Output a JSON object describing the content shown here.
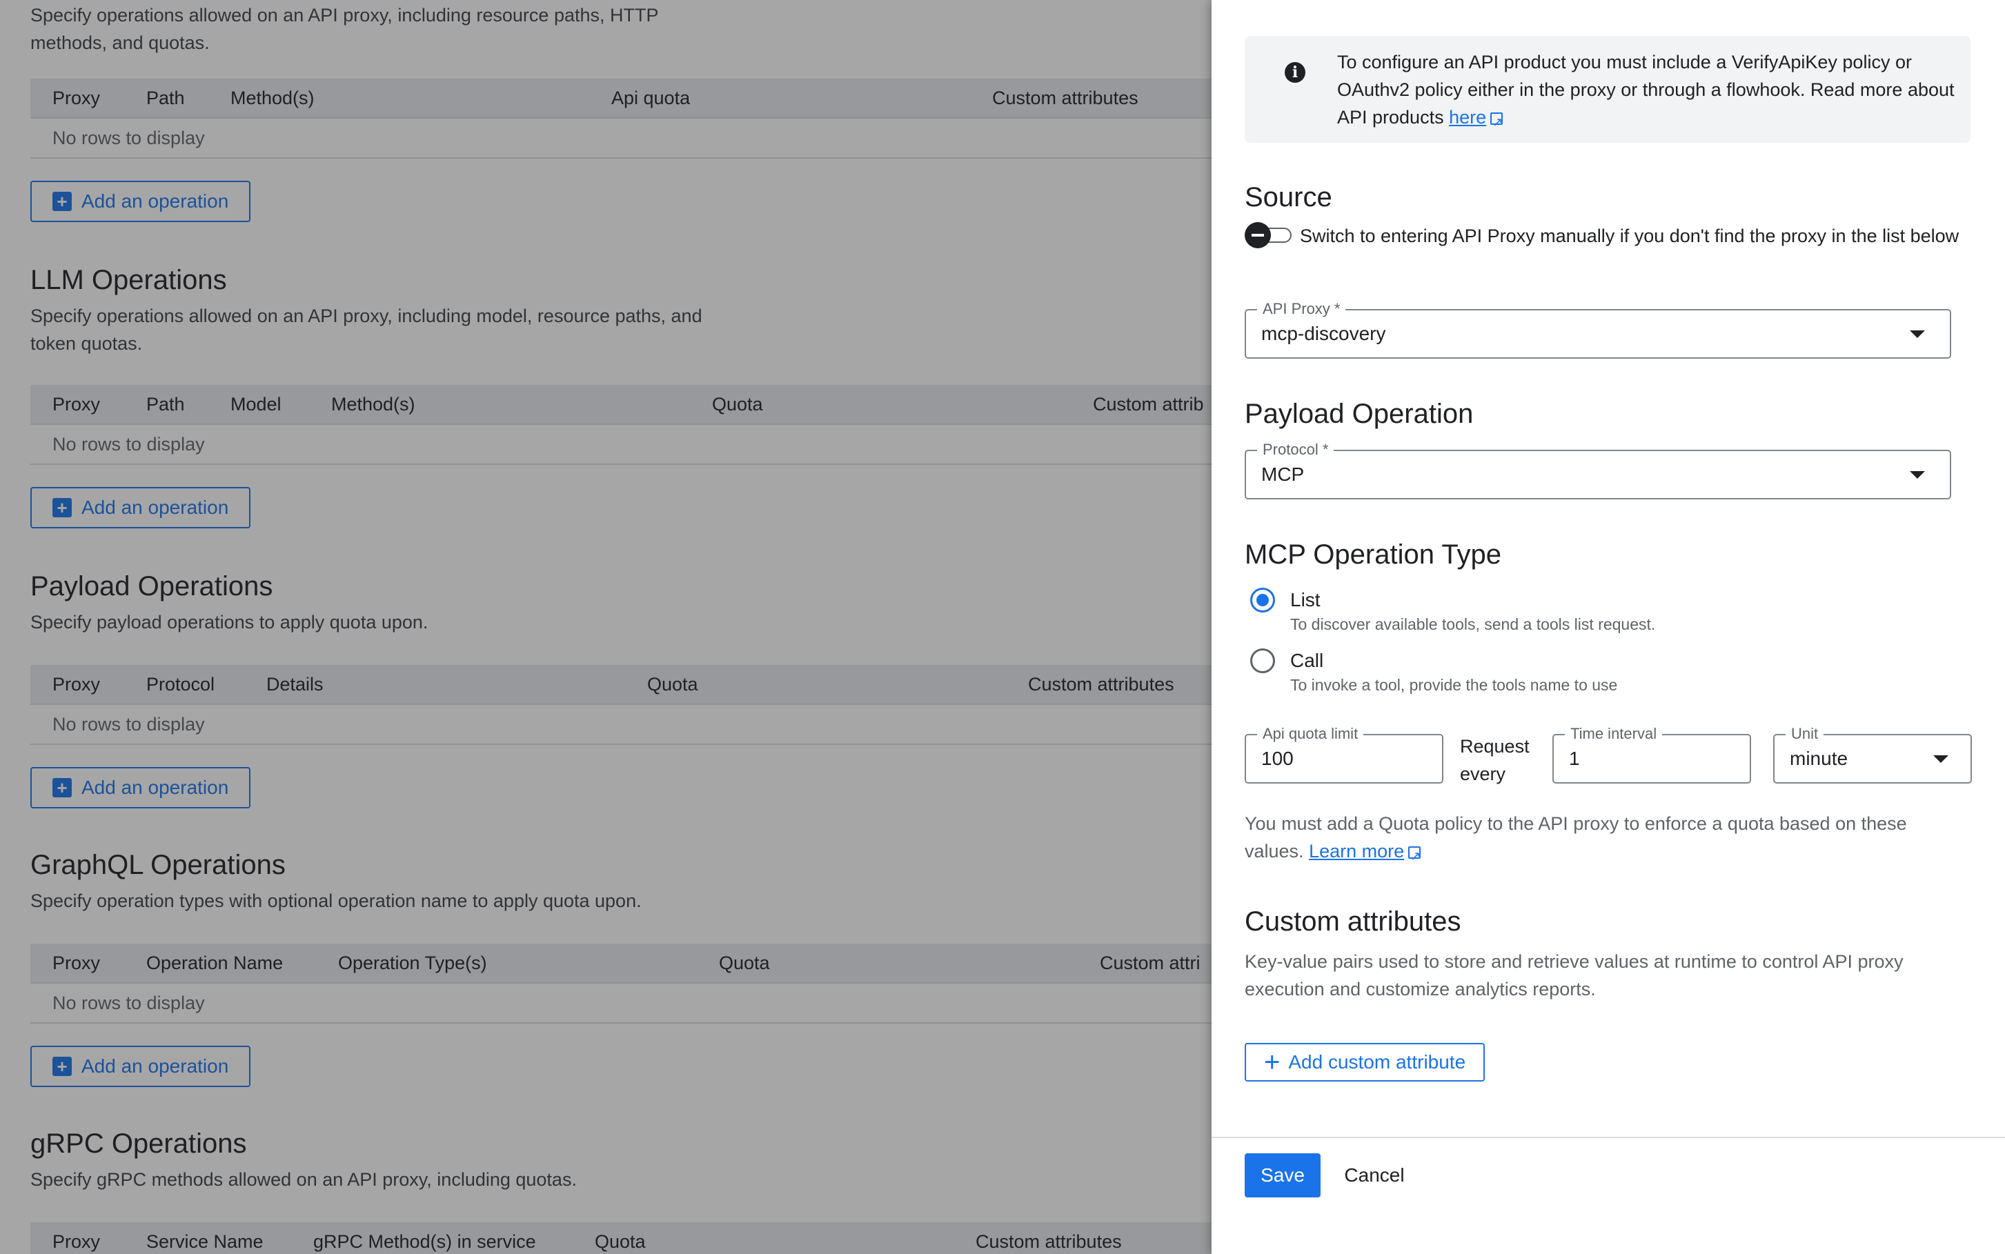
{
  "colors": {
    "accent": "#1a73e8",
    "scrim": "rgba(32,33,36,0.4)"
  },
  "background": {
    "top_desc": "Specify operations allowed on an API proxy, including resource paths, HTTP methods, and quotas.",
    "top_headers": [
      "Proxy",
      "Path",
      "Method(s)",
      "Api quota",
      "Custom attributes"
    ],
    "empty_text": "No rows to display",
    "add_label": "Add an operation",
    "llm": {
      "title": "LLM Operations",
      "desc": "Specify operations allowed on an API proxy, including model, resource paths, and token quotas.",
      "headers": [
        "Proxy",
        "Path",
        "Model",
        "Method(s)",
        "Quota",
        "Custom attrib"
      ]
    },
    "payload": {
      "title": "Payload Operations",
      "desc": "Specify payload operations to apply quota upon.",
      "headers": [
        "Proxy",
        "Protocol",
        "Details",
        "Quota",
        "Custom attributes"
      ]
    },
    "graphql": {
      "title": "GraphQL Operations",
      "desc": "Specify operation types with optional operation name to apply quota upon.",
      "headers": [
        "Proxy",
        "Operation Name",
        "Operation Type(s)",
        "Quota",
        "Custom attri"
      ]
    },
    "grpc": {
      "title": "gRPC Operations",
      "desc": "Specify gRPC methods allowed on an API proxy, including quotas.",
      "headers": [
        "Proxy",
        "Service Name",
        "gRPC Method(s) in service",
        "Quota",
        "Custom attributes"
      ]
    }
  },
  "panel": {
    "info": {
      "icon": "info-icon",
      "text": "To configure an API product you must include a VerifyApiKey policy or OAuthv2 policy either in the proxy or through a flowhook. Read more about API products",
      "link": "here"
    },
    "source": {
      "title": "Source",
      "toggle_label": "Switch to entering API Proxy manually if you don't find the proxy in the list below",
      "toggle_on": false
    },
    "api_proxy": {
      "label": "API Proxy *",
      "value": "mcp-discovery"
    },
    "payload_operation": {
      "title": "Payload Operation",
      "protocol_label": "Protocol *",
      "protocol_value": "MCP"
    },
    "mcp": {
      "title": "MCP Operation Type",
      "options": [
        {
          "label": "List",
          "sub": "To discover available tools, send a tools list request.",
          "selected": true
        },
        {
          "label": "Call",
          "sub": "To invoke a tool, provide the tools name to use",
          "selected": false
        }
      ]
    },
    "quota": {
      "limit_label": "Api quota limit",
      "limit_value": "100",
      "request_every_1": "Request",
      "request_every_2": "every",
      "interval_label": "Time interval",
      "interval_value": "1",
      "unit_label": "Unit",
      "unit_value": "minute",
      "note": "You must add a Quota policy to the API proxy to enforce a quota based on these values.",
      "learn_more": "Learn more"
    },
    "custom_attributes": {
      "title": "Custom attributes",
      "desc": "Key-value pairs used to store and retrieve values at runtime to control API proxy execution and customize analytics reports.",
      "add_label": "Add custom attribute"
    },
    "footer": {
      "save": "Save",
      "cancel": "Cancel"
    }
  }
}
